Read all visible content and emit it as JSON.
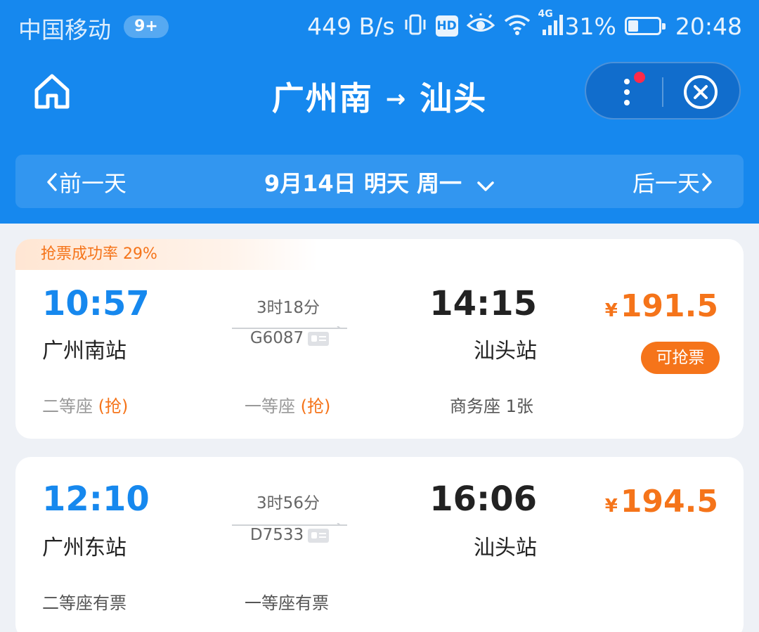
{
  "status_bar": {
    "carrier": "中国移动",
    "notif_count": "9+",
    "net_speed": "449 B/s",
    "hd": "HD",
    "network": "4G",
    "battery": "31%",
    "battery_level": 0.31,
    "time": "20:48"
  },
  "nav": {
    "route_from": "广州南",
    "route_arrow": "→",
    "route_to": "汕头"
  },
  "date_bar": {
    "prev_label": "前一天",
    "current_date": "9月14日 明天 周一",
    "next_label": "后一天"
  },
  "trains": [
    {
      "promo": "抢票成功率 29%",
      "dep_time": "10:57",
      "dep_station": "广州南站",
      "duration": "3时18分",
      "train_no": "G6087",
      "arr_time": "14:15",
      "arr_station": "汕头站",
      "price_symbol": "¥",
      "price": "191.5",
      "action": "可抢票",
      "seats": [
        {
          "name": "二等座",
          "status": "(抢)"
        },
        {
          "name": "一等座",
          "status": "(抢)"
        },
        {
          "name": "商务座",
          "status": "1张"
        }
      ]
    },
    {
      "dep_time": "12:10",
      "dep_station": "广州东站",
      "duration": "3时56分",
      "train_no": "D7533",
      "arr_time": "16:06",
      "arr_station": "汕头站",
      "price_symbol": "¥",
      "price": "194.5",
      "seats": [
        {
          "name": "二等座",
          "status": "有票"
        },
        {
          "name": "一等座",
          "status": "有票"
        }
      ]
    }
  ],
  "colors": {
    "header_blue": "#1688ee",
    "accent_orange": "#f5741a",
    "badge_red": "#ff2a4a"
  }
}
